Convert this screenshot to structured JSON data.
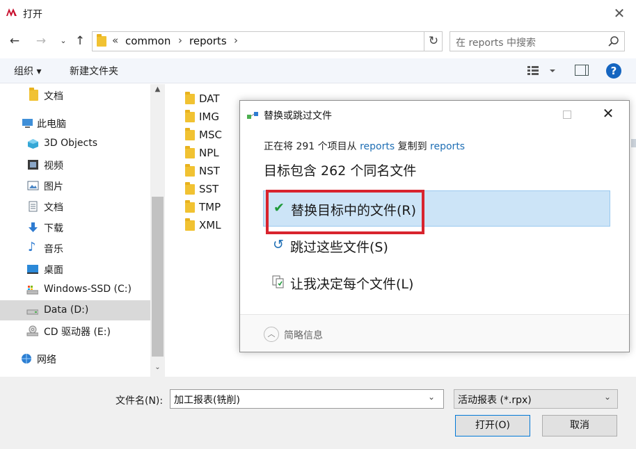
{
  "window": {
    "title": "打开"
  },
  "address": {
    "overflow": "«",
    "crumbs": [
      "common",
      "reports"
    ],
    "search_placeholder": "在 reports 中搜索"
  },
  "toolbar": {
    "organize": "组织 ▾",
    "new_folder": "新建文件夹"
  },
  "nav": {
    "items": [
      {
        "label": "文档",
        "icon": "folder-icon"
      },
      {
        "label": "此电脑",
        "icon": "computer-icon"
      },
      {
        "label": "3D Objects",
        "icon": "cube-icon"
      },
      {
        "label": "视频",
        "icon": "video-icon"
      },
      {
        "label": "图片",
        "icon": "picture-icon"
      },
      {
        "label": "文档",
        "icon": "document-icon"
      },
      {
        "label": "下载",
        "icon": "download-icon"
      },
      {
        "label": "音乐",
        "icon": "music-icon"
      },
      {
        "label": "桌面",
        "icon": "desktop-icon"
      },
      {
        "label": "Windows-SSD (C:)",
        "icon": "drive-icon"
      },
      {
        "label": "Data (D:)",
        "icon": "drive-icon",
        "selected": true
      },
      {
        "label": "CD 驱动器 (E:)",
        "icon": "cd-drive-icon"
      },
      {
        "label": "网络",
        "icon": "network-icon"
      }
    ]
  },
  "files": [
    "DAT",
    "IMG",
    "MSC",
    "NPL",
    "NST",
    "SST",
    "TMP",
    "XML"
  ],
  "bottom": {
    "filename_label": "文件名(N):",
    "filename_value": "加工报表(铣削)",
    "filetype_value": "活动报表 (*.rpx)",
    "open_label": "打开(O)",
    "cancel_label": "取消"
  },
  "dialog": {
    "title": "替换或跳过文件",
    "info_prefix": "正在将 291 个项目从 ",
    "info_src": "reports",
    "info_mid": " 复制到 ",
    "info_dst": "reports",
    "heading": "目标包含 262 个同名文件",
    "options": [
      {
        "label": "替换目标中的文件(R)",
        "icon": "checkmark-icon",
        "selected": true
      },
      {
        "label": "跳过这些文件(S)",
        "icon": "skip-icon"
      },
      {
        "label": "让我决定每个文件(L)",
        "icon": "decide-icon"
      }
    ],
    "details": "简略信息"
  },
  "colors": {
    "accent": "#1f6fb5",
    "selection": "#cce4f7",
    "highlight": "#d8242e",
    "folder": "#f1c232"
  }
}
